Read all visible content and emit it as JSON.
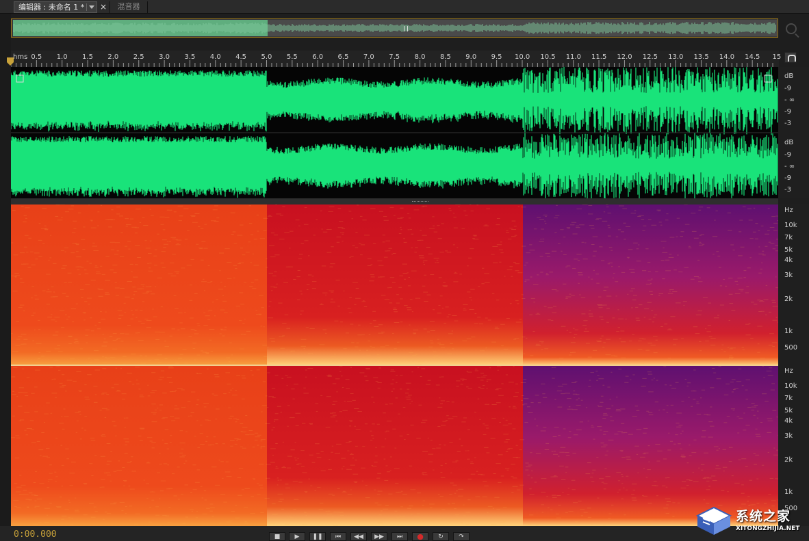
{
  "tabs": {
    "editor_label": "编辑器 : 未命名 1 *",
    "close_label": "×",
    "mixer_label": "混音器"
  },
  "ruler": {
    "unit_label": "hms",
    "tick_labels": [
      "0.5",
      "1.0",
      "1.5",
      "2.0",
      "2.5",
      "3.0",
      "3.5",
      "4.0",
      "4.5",
      "5.0",
      "5.5",
      "6.0",
      "6.5",
      "7.0",
      "7.5",
      "8.0",
      "8.5",
      "9.0",
      "9.5",
      "10.0",
      "10.5",
      "11.0",
      "11.5",
      "12.0",
      "12.5",
      "13.0",
      "13.5",
      "14.0",
      "14.5",
      "15"
    ]
  },
  "waveform": {
    "channel_top_db": [
      "dB",
      "-9",
      "- ∞",
      "-9",
      "-3"
    ],
    "channel_bottom_db": [
      "dB",
      "-9",
      "- ∞",
      "-9",
      "-3"
    ],
    "colors": {
      "wave": "#19e37a",
      "background": "#050505"
    }
  },
  "spectral": {
    "channel_top_hz": [
      "Hz",
      "10k",
      "7k",
      "5k",
      "4k",
      "3k",
      "2k",
      "1k",
      "500"
    ],
    "channel_bottom_hz": [
      "Hz",
      "10k",
      "7k",
      "5k",
      "4k",
      "3k",
      "2k",
      "1k",
      "500"
    ],
    "colors": {
      "segment1": "#e84018",
      "segment2": "#c81020",
      "segment3": "#5e1070",
      "low_freq_hot": "#ffd27a"
    }
  },
  "transport": {
    "time": "0:00.000",
    "buttons": [
      {
        "name": "stop-button",
        "glyph": "■"
      },
      {
        "name": "play-button",
        "glyph": "▶"
      },
      {
        "name": "pause-button",
        "glyph": "❚❚"
      },
      {
        "name": "go-to-start-button",
        "glyph": "⏮"
      },
      {
        "name": "rewind-button",
        "glyph": "◀◀"
      },
      {
        "name": "fast-forward-button",
        "glyph": "▶▶"
      },
      {
        "name": "go-to-end-button",
        "glyph": "⏭"
      },
      {
        "name": "record-button",
        "glyph": "●"
      },
      {
        "name": "loop-button",
        "glyph": "↻"
      },
      {
        "name": "skip-selection-button",
        "glyph": "↷"
      }
    ]
  },
  "watermark": {
    "title": "系统之家",
    "url": "XITONGZHIJIA.NET"
  }
}
